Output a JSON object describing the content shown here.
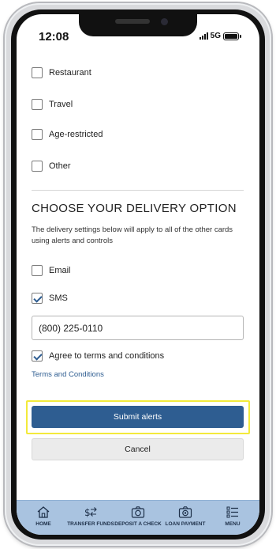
{
  "status_bar": {
    "time": "12:08",
    "network": "5G"
  },
  "categories": [
    {
      "label": "Restaurant",
      "checked": false
    },
    {
      "label": "Travel",
      "checked": false
    },
    {
      "label": "Age-restricted",
      "checked": false
    },
    {
      "label": "Other",
      "checked": false
    }
  ],
  "delivery": {
    "title": "CHOOSE YOUR DELIVERY OPTION",
    "description": "The delivery settings below will apply to all of the other cards using alerts and controls",
    "email_label": "Email",
    "email_checked": false,
    "sms_label": "SMS",
    "sms_checked": true,
    "phone_value": "(800) 225-0110",
    "terms_label": "Agree to terms and conditions",
    "terms_checked": true,
    "terms_link": "Terms and Conditions"
  },
  "actions": {
    "submit_label": "Submit alerts",
    "cancel_label": "Cancel"
  },
  "tab_bar": {
    "items": [
      {
        "label": "HOME",
        "icon": "home-icon"
      },
      {
        "label": "TRANSFER FUNDS",
        "icon": "transfer-icon"
      },
      {
        "label": "DEPOSIT A CHECK",
        "icon": "camera-icon"
      },
      {
        "label": "LOAN PAYMENT",
        "icon": "loan-payment-icon"
      },
      {
        "label": "MENU",
        "icon": "menu-icon"
      }
    ]
  },
  "colors": {
    "primary": "#2e5d91",
    "highlight": "#f3ea3b",
    "tab_bar": "#a9c3e0"
  }
}
